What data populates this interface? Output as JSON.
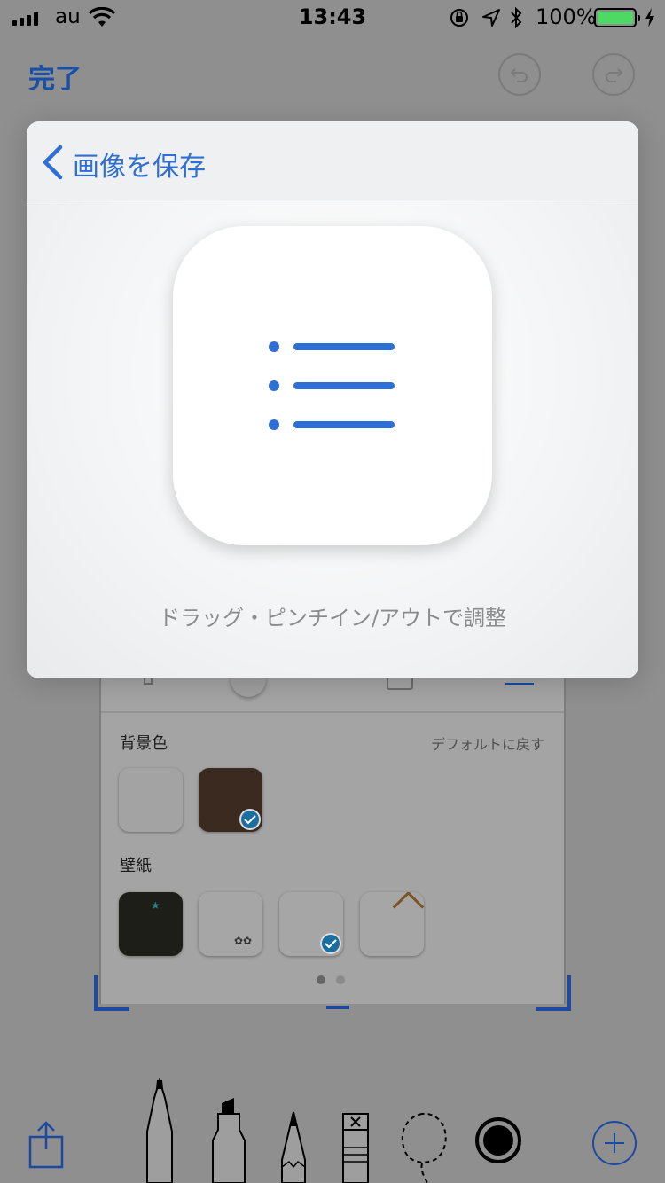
{
  "status_bar": {
    "carrier": "au",
    "time": "13:43",
    "battery_percent": "100%",
    "battery_level": 1.0,
    "battery_color": "#4cd964"
  },
  "navbar": {
    "done_label": "完了",
    "undo_icon": "undo-icon",
    "redo_icon": "redo-icon"
  },
  "background_panel": {
    "background_color_label": "背景色",
    "reset_label": "デフォルトに戻す",
    "swatches": [
      {
        "color": "#f4f4f4",
        "selected": false
      },
      {
        "color": "#3b2a1f",
        "selected": true
      }
    ],
    "wallpaper_label": "壁紙",
    "wallpapers": [
      {
        "selected": false
      },
      {
        "selected": false
      },
      {
        "selected": true
      },
      {
        "selected": false
      }
    ],
    "page_count": 2,
    "current_page": 1
  },
  "popover": {
    "back_label": "画像を保存",
    "hint": "ドラッグ・ピンチイン/アウトで調整",
    "icon": "list-icon",
    "accent_color": "#2e6fd6"
  },
  "toolbar": {
    "tools": [
      "pen-icon",
      "marker-icon",
      "pencil-icon",
      "eraser-icon",
      "lasso-icon"
    ],
    "selected_color": "#000000",
    "share_icon": "share-icon",
    "add_icon": "plus-icon"
  }
}
